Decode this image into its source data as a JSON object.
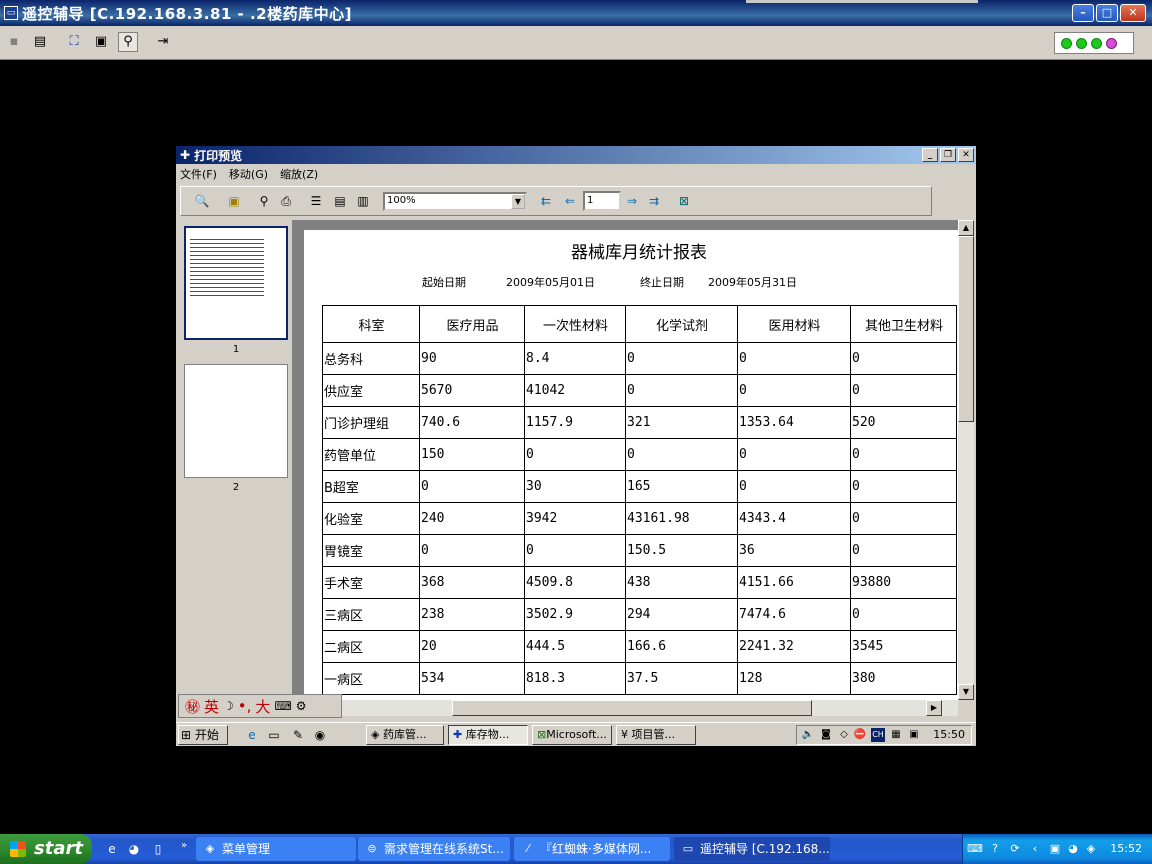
{
  "remote_window": {
    "title": "遥控辅导 [C.192.168.3.81 - .2楼药库中心]",
    "icons": [
      "save-icon",
      "screen-icon",
      "fit-screen-icon",
      "window-icon",
      "zoom-icon",
      "exit-icon"
    ]
  },
  "print_preview": {
    "title": "打印预览",
    "menu": [
      "文件(F)",
      "移动(G)",
      "缩放(Z)"
    ],
    "zoom_value": "100%",
    "page_value": "1",
    "thumbnails": [
      "1",
      "2"
    ]
  },
  "report": {
    "title": "器械库月统计报表",
    "start_label": "起始日期",
    "start_date": "2009年05月01日",
    "end_label": "终止日期",
    "end_date": "2009年05月31日",
    "headers": [
      "科室",
      "医疗用品",
      "一次性材料",
      "化学试剂",
      "医用材料",
      "其他卫生材料"
    ],
    "rows": [
      [
        "总务科",
        "90",
        "8.4",
        "0",
        "0",
        "0"
      ],
      [
        "供应室",
        "5670",
        "41042",
        "0",
        "0",
        "0"
      ],
      [
        "门诊护理组",
        "740.6",
        "1157.9",
        "321",
        "1353.64",
        "520"
      ],
      [
        "药管单位",
        "150",
        "0",
        "0",
        "0",
        "0"
      ],
      [
        "B超室",
        "0",
        "30",
        "165",
        "0",
        "0"
      ],
      [
        "化验室",
        "240",
        "3942",
        "43161.98",
        "4343.4",
        "0"
      ],
      [
        "胃镜室",
        "0",
        "0",
        "150.5",
        "36",
        "0"
      ],
      [
        "手术室",
        "368",
        "4509.8",
        "438",
        "4151.66",
        "93880"
      ],
      [
        "三病区",
        "238",
        "3502.9",
        "294",
        "7474.6",
        "0"
      ],
      [
        "二病区",
        "20",
        "444.5",
        "166.6",
        "2241.32",
        "3545"
      ],
      [
        "一病区",
        "534",
        "818.3",
        "37.5",
        "128",
        "380"
      ]
    ]
  },
  "ime_bar": {
    "text": "英",
    "full": "大"
  },
  "remote_taskbar": {
    "start": "开始",
    "tasks": [
      "药库管...",
      "库存物...",
      "Microsoft...",
      "项目管..."
    ],
    "clock": "15:50",
    "tray_lang": "CH"
  },
  "local_taskbar": {
    "start": "start",
    "tasks": [
      "菜单管理",
      "需求管理在线系统St...",
      "『红蜘蛛·多媒体网...",
      "遥控辅导 [C.192.168..."
    ],
    "clock": "15:52"
  }
}
